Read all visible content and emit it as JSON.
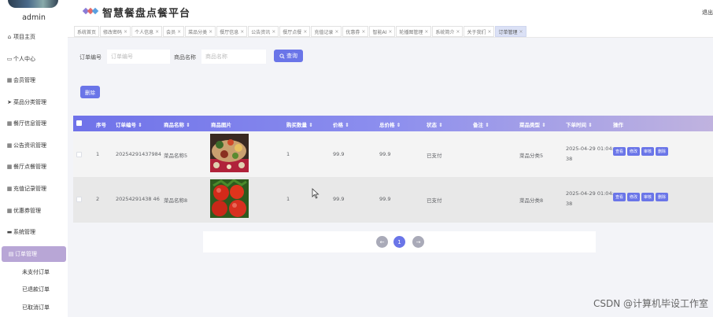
{
  "user": {
    "name": "admin"
  },
  "sidebar": {
    "items": [
      {
        "label": "项目主页",
        "icon": "home-icon",
        "glyph": "⌂"
      },
      {
        "label": "个人中心",
        "icon": "user-card-icon",
        "glyph": "▭"
      },
      {
        "label": "会员管理",
        "icon": "grid-icon",
        "glyph": "▦"
      },
      {
        "label": "菜品分类管理",
        "icon": "send-icon",
        "glyph": "➤"
      },
      {
        "label": "餐厅信息管理",
        "icon": "grid-icon",
        "glyph": "▦"
      },
      {
        "label": "公告资讯管理",
        "icon": "grid-icon",
        "glyph": "▦"
      },
      {
        "label": "餐厅点餐管理",
        "icon": "grid-icon",
        "glyph": "▦"
      },
      {
        "label": "充值记录管理",
        "icon": "grid-icon",
        "glyph": "▦"
      },
      {
        "label": "优惠券管理",
        "icon": "grid-icon",
        "glyph": "▦"
      },
      {
        "label": "系统管理",
        "icon": "briefcase-icon",
        "glyph": "▬"
      },
      {
        "label": "订单管理",
        "icon": "order-icon",
        "glyph": "▤"
      }
    ],
    "sub_items": [
      {
        "label": "未支付订单"
      },
      {
        "label": "已退款订单"
      },
      {
        "label": "已取消订单"
      }
    ]
  },
  "header": {
    "title": "智慧餐盘点餐平台",
    "exit_label": "退出"
  },
  "tabs": [
    {
      "label": "系统首页"
    },
    {
      "label": "修改密码"
    },
    {
      "label": "个人信息"
    },
    {
      "label": "会员"
    },
    {
      "label": "菜品分类"
    },
    {
      "label": "餐厅信息"
    },
    {
      "label": "公告资讯"
    },
    {
      "label": "餐厅点餐"
    },
    {
      "label": "充值记录"
    },
    {
      "label": "优惠券"
    },
    {
      "label": "智能AI"
    },
    {
      "label": "轮播图管理"
    },
    {
      "label": "系统简介"
    },
    {
      "label": "关于我们"
    },
    {
      "label": "订单管理",
      "active": true
    }
  ],
  "tab_close_glyph": "×",
  "search": {
    "order_no_label": "订单编号",
    "order_no_placeholder": "订单编号",
    "dish_name_label": "商品名称",
    "dish_name_placeholder": "商品名称",
    "search_button": "查询",
    "delete_button": "删除"
  },
  "table": {
    "columns": {
      "index": "序号",
      "order_no": "订单编号",
      "dish_name": "商品名称",
      "image": "商品图片",
      "qty": "购买数量",
      "price": "价格",
      "total": "总价格",
      "status": "状态",
      "remark": "备注",
      "category": "菜品类型",
      "time": "下单时间",
      "actions": "操作"
    },
    "sort_glyph": "⇕",
    "rows": [
      {
        "index": "1",
        "order_no": "20254291437984",
        "dish_name": "菜品名称5",
        "qty": "1",
        "price": "99.9",
        "total": "99.9",
        "status": "已支付",
        "remark": "",
        "category": "菜品分类5",
        "time_l1": "2025-04-29 01:04:",
        "time_l2": "38",
        "image": "platter"
      },
      {
        "index": "2",
        "order_no": "20254291438 46",
        "dish_name": "菜品名称8",
        "qty": "1",
        "price": "99.9",
        "total": "99.9",
        "status": "已支付",
        "remark": "",
        "category": "菜品分类8",
        "time_l1": "2025-04-29 01:04:",
        "time_l2": "38",
        "image": "tomatoes"
      }
    ],
    "actions": {
      "view": "查看",
      "edit": "修改",
      "review": "审核",
      "delete": "删除"
    }
  },
  "pagination": {
    "prev_glyph": "←",
    "current": "1",
    "next_glyph": "→"
  },
  "watermark": "CSDN @计算机毕设工作室",
  "colors": {
    "primary": "#6a75e8",
    "sidebar_active": "#b8a6d6"
  }
}
